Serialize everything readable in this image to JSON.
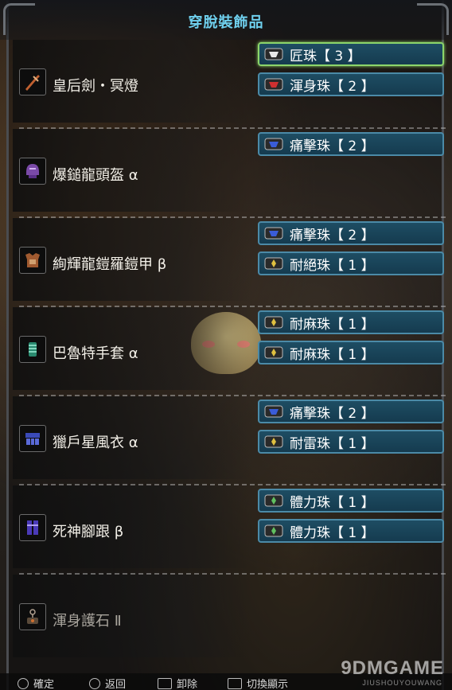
{
  "title": "穿脫裝飾品",
  "colors": {
    "title": "#6fd0ee",
    "slot_bg": "#1e4d63",
    "slot_border": "#4b8aa7",
    "selected_border": "#8cd56a"
  },
  "equipment": [
    {
      "name": "皇后劍・冥燈",
      "icon": "sword-icon",
      "dim": false,
      "slots": [
        {
          "label": "匠珠【 3 】",
          "gem": "white-gem-icon",
          "selected": true
        },
        {
          "label": "渾身珠【 2 】",
          "gem": "red-gem-icon",
          "selected": false
        }
      ]
    },
    {
      "name": "爆鎚龍頭盔 α",
      "icon": "helmet-icon",
      "dim": false,
      "slots": [
        {
          "label": "痛擊珠【 2 】",
          "gem": "blue-gem-icon",
          "selected": false
        }
      ]
    },
    {
      "name": "絢輝龍鎧羅鎧甲 β",
      "icon": "chest-armor-icon",
      "dim": false,
      "slots": [
        {
          "label": "痛擊珠【 2 】",
          "gem": "blue-gem-icon",
          "selected": false
        },
        {
          "label": "耐絕珠【 1 】",
          "gem": "yellow-gem-icon",
          "selected": false
        }
      ]
    },
    {
      "name": "巴魯特手套 α",
      "icon": "gloves-icon",
      "dim": false,
      "slots": [
        {
          "label": "耐麻珠【 1 】",
          "gem": "yellow-gem-icon",
          "selected": false
        },
        {
          "label": "耐麻珠【 1 】",
          "gem": "yellow-gem-icon",
          "selected": false
        }
      ]
    },
    {
      "name": "獵戶星風衣 α",
      "icon": "waist-icon",
      "dim": false,
      "slots": [
        {
          "label": "痛擊珠【 2 】",
          "gem": "blue-gem-icon",
          "selected": false
        },
        {
          "label": "耐雷珠【 1 】",
          "gem": "yellow-gem-icon",
          "selected": false
        }
      ]
    },
    {
      "name": "死神腳跟 β",
      "icon": "legs-icon",
      "dim": false,
      "slots": [
        {
          "label": "體力珠【 1 】",
          "gem": "green-gem-icon",
          "selected": false
        },
        {
          "label": "體力珠【 1 】",
          "gem": "green-gem-icon",
          "selected": false
        }
      ]
    },
    {
      "name": "渾身護石 Ⅱ",
      "icon": "charm-icon",
      "dim": true,
      "slots": []
    }
  ],
  "footer": {
    "hints": [
      {
        "label": "確定",
        "button": "circle-button-icon"
      },
      {
        "label": "返回",
        "button": "circle-button-icon"
      },
      {
        "label": "卸除",
        "button": "square-button-icon"
      },
      {
        "label": "切換顯示",
        "button": "square-button-icon"
      }
    ]
  },
  "watermark": {
    "text": "9DMGAME",
    "sub": "JIUSHOUYOUWANG"
  }
}
